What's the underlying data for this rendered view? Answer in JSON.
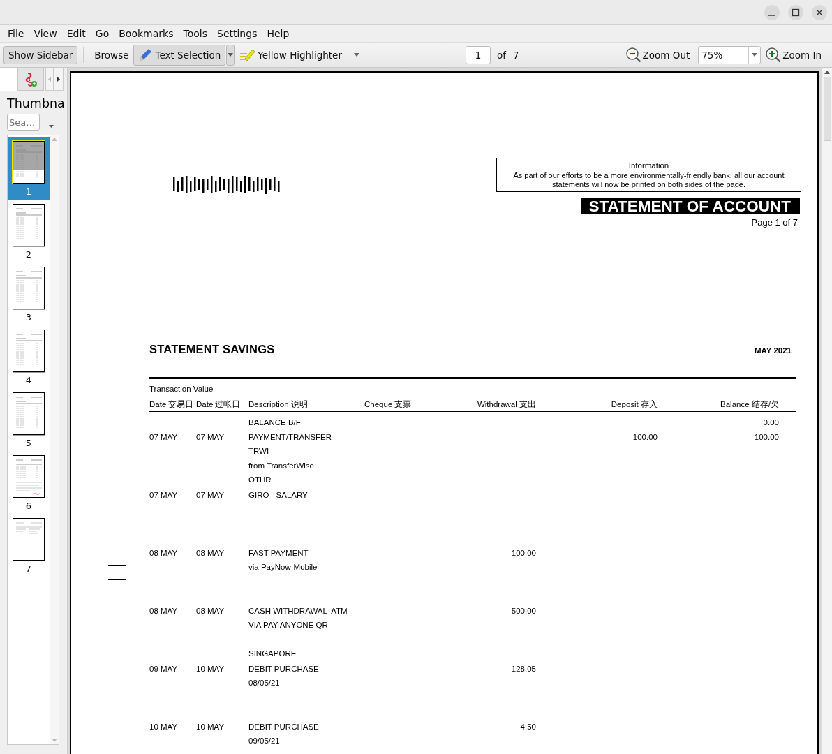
{
  "window": {
    "controls": [
      {
        "kind": "minimize"
      },
      {
        "kind": "maximize"
      },
      {
        "kind": "close"
      }
    ]
  },
  "menu": [
    "File",
    "View",
    "Edit",
    "Go",
    "Bookmarks",
    "Tools",
    "Settings",
    "Help"
  ],
  "toolbar": {
    "show_sidebar": {
      "label": "Show Sidebar",
      "pressed": true
    },
    "modes": [
      {
        "kind": "browse",
        "label": "Browse",
        "selected": false
      },
      {
        "kind": "select",
        "label": "Text Selection",
        "selected": true
      }
    ],
    "highlighter": "Yellow Highlighter",
    "page_field": "1",
    "page_of": "of",
    "page_total": "7",
    "zoom_out": "Zoom Out",
    "zoom_level": "75%",
    "zoom_in": "Zoom In"
  },
  "sidebar": {
    "title": "Thumbna",
    "search": {
      "placeholder": "Sea…"
    },
    "thumbnails": [
      {
        "label": "1",
        "selected": true,
        "kind": "table"
      },
      {
        "label": "2",
        "selected": false,
        "kind": "table"
      },
      {
        "label": "3",
        "selected": false,
        "kind": "table"
      },
      {
        "label": "4",
        "selected": false,
        "kind": "table"
      },
      {
        "label": "5",
        "selected": false,
        "kind": "table"
      },
      {
        "label": "6",
        "selected": false,
        "kind": "notes"
      },
      {
        "label": "7",
        "selected": false,
        "kind": "short"
      }
    ]
  },
  "document": {
    "notice": {
      "title": "Information",
      "text": "As part of our efforts to be a more environmentally-friendly bank, all our account statements will now be printed on both sides of the page."
    },
    "heading": "STATEMENT OF ACCOUNT",
    "page_label": "Page 1 of 7",
    "account_type": "STATEMENT SAVINGS",
    "period": "MAY 2021",
    "header_top": "Transaction Value",
    "columns": [
      "Date 交易日",
      "Date 过帐日",
      "Description 说明",
      "Cheque 支票",
      "Withdrawal 支出",
      "Deposit 存入",
      "Balance 结存/欠"
    ],
    "rows": [
      {
        "description": [
          "BALANCE B/F"
        ],
        "balance": "0.00"
      },
      {
        "date": "07 MAY",
        "value_date": "07 MAY",
        "description": [
          "PAYMENT/TRANSFER",
          "TRWI",
          "from TransferWise",
          "OTHR"
        ],
        "deposit": "100.00",
        "balance": "100.00"
      },
      {
        "date": "07 MAY",
        "value_date": "07 MAY",
        "description": [
          "GIRO - SALARY"
        ]
      },
      {
        "date": "08 MAY",
        "value_date": "08 MAY",
        "description": [
          "FAST PAYMENT",
          "via PayNow-Mobile"
        ],
        "withdrawal": "100.00"
      },
      {
        "date": "08 MAY",
        "value_date": "08 MAY",
        "description": [
          "CASH WITHDRAWAL  ATM",
          "VIA PAY ANYONE QR"
        ],
        "note": "SINGAPORE",
        "withdrawal": "500.00"
      },
      {
        "date": "09 MAY",
        "value_date": "10 MAY",
        "description": [
          "DEBIT PURCHASE",
          "08/05/21"
        ],
        "withdrawal": "128.05"
      },
      {
        "date": "10 MAY",
        "value_date": "10 MAY",
        "description": [
          "DEBIT PURCHASE",
          "09/05/21"
        ],
        "withdrawal": "4.50"
      }
    ]
  }
}
